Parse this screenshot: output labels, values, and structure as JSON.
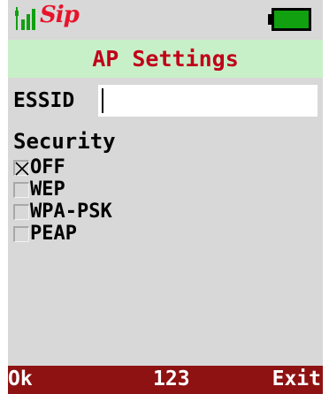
{
  "status_bar": {
    "signal_icon": "signal-bars-icon",
    "logo": "Sip",
    "battery_icon": "battery-full-icon",
    "battery_color": "#10a010"
  },
  "header": {
    "title": "AP Settings"
  },
  "form": {
    "essid_label": "ESSID",
    "essid_value": "",
    "security_label": "Security",
    "options": [
      {
        "label": "OFF",
        "checked": true
      },
      {
        "label": "WEP",
        "checked": false
      },
      {
        "label": "WPA-PSK",
        "checked": false
      },
      {
        "label": "PEAP",
        "checked": false
      }
    ]
  },
  "softkeys": {
    "left": "Ok",
    "center": "123",
    "right": "Exit"
  },
  "colors": {
    "title_bg": "#c8f0c8",
    "title_text": "#c0001a",
    "softkey_bg": "#8e1212",
    "background": "#d8d8d8"
  }
}
